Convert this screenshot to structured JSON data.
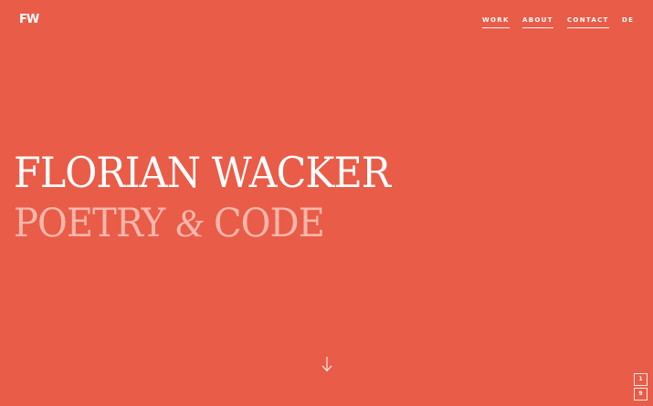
{
  "brand": {
    "logo": "FW"
  },
  "nav": {
    "items": [
      {
        "label": "WORK"
      },
      {
        "label": "ABOUT"
      },
      {
        "label": "CONTACT"
      },
      {
        "label": "DE"
      }
    ]
  },
  "hero": {
    "title": "FLORIAN WACKER",
    "subtitle_left": "POETRY ",
    "subtitle_amp": "&",
    "subtitle_right": " CODE"
  },
  "scroll": {
    "icon": "arrow-down-icon"
  },
  "pager": {
    "current": "1",
    "total": "9"
  },
  "colors": {
    "background": "#e95c48",
    "text": "#ffffff",
    "subtitle": "#f7b7ab"
  }
}
